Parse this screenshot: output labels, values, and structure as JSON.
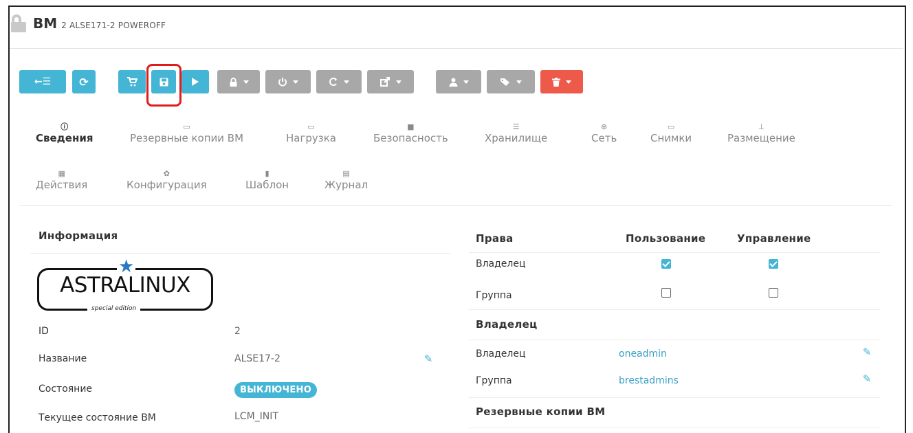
{
  "header": {
    "title": "ВМ",
    "subtitle": "2 ALSE171-2 POWEROFF"
  },
  "toolbar": {
    "buttons": [
      {
        "name": "back-list-button",
        "icon": "←☰",
        "caret": false,
        "color": "#45b5d6"
      },
      {
        "name": "refresh-button",
        "icon": "⟳",
        "caret": false,
        "color": "#45b5d6"
      },
      {
        "name": "deploy-cart-button",
        "icon": "🛒",
        "caret": false,
        "color": "#45b5d6"
      },
      {
        "name": "save-button",
        "icon": "💾",
        "caret": false,
        "color": "#45b5d6"
      },
      {
        "name": "play-button",
        "icon": "▶",
        "caret": false,
        "color": "#45b5d6"
      },
      {
        "name": "lock-menu-button",
        "icon": "🔒",
        "caret": true,
        "color": "#a8a8a8"
      },
      {
        "name": "power-menu-button",
        "icon": "⏻",
        "caret": true,
        "color": "#a8a8a8"
      },
      {
        "name": "reboot-menu-button",
        "icon": "↻",
        "caret": true,
        "color": "#a8a8a8"
      },
      {
        "name": "export-menu-button",
        "icon": "⇪",
        "caret": true,
        "color": "#a8a8a8"
      },
      {
        "name": "user-menu-button",
        "icon": "👤",
        "caret": true,
        "color": "#a8a8a8"
      },
      {
        "name": "tag-menu-button",
        "icon": "🏷",
        "caret": true,
        "color": "#a8a8a8"
      },
      {
        "name": "delete-menu-button",
        "icon": "🗑",
        "caret": true,
        "color": "#ee5a4a"
      }
    ]
  },
  "tabs": [
    {
      "label": "Сведения",
      "icon": "info-icon",
      "glyph": "ⓘ",
      "active": true
    },
    {
      "label": "Резервные копии ВМ",
      "icon": "archive-icon",
      "glyph": "▭",
      "active": false
    },
    {
      "label": "Нагрузка",
      "icon": "laptop-icon",
      "glyph": "▭",
      "active": false
    },
    {
      "label": "Безопасность",
      "icon": "lock-icon",
      "glyph": "🔒",
      "active": false
    },
    {
      "label": "Хранилище",
      "icon": "storage-icon",
      "glyph": "☰",
      "active": false
    },
    {
      "label": "Сеть",
      "icon": "globe-icon",
      "glyph": "⊕",
      "active": false
    },
    {
      "label": "Снимки",
      "icon": "laptop-icon",
      "glyph": "▭",
      "active": false
    },
    {
      "label": "Размещение",
      "icon": "sitemap-icon",
      "glyph": "⊥",
      "active": false
    },
    {
      "label": "Действия",
      "icon": "calendar-icon",
      "glyph": "▦",
      "active": false
    },
    {
      "label": "Конфигурация",
      "icon": "gear-icon",
      "glyph": "✿",
      "active": false
    },
    {
      "label": "Шаблон",
      "icon": "file-icon",
      "glyph": "▮",
      "active": false
    },
    {
      "label": "Журнал",
      "icon": "file-text-icon",
      "glyph": "▤",
      "active": false
    }
  ],
  "info": {
    "heading": "Информация",
    "logo": {
      "text": "ASTRALINUX",
      "tagline": "special edition"
    },
    "rows": [
      {
        "label": "ID",
        "value": "2"
      },
      {
        "label": "Название",
        "value": "ALSE17-2"
      },
      {
        "label": "Состояние",
        "value": "ВЫКЛЮЧЕНО"
      },
      {
        "label": "Текущее состояние ВМ",
        "value": "LCM_INIT"
      }
    ]
  },
  "permissions": {
    "heading": "Права",
    "col_use": "Пользование",
    "col_manage": "Управление",
    "rows": [
      {
        "label": "Владелец",
        "use": true,
        "manage": true
      },
      {
        "label": "Группа",
        "use": false,
        "manage": false
      }
    ]
  },
  "ownership": {
    "heading": "Владелец",
    "rows": [
      {
        "label": "Владелец",
        "value": "oneadmin"
      },
      {
        "label": "Группа",
        "value": "brestadmins"
      }
    ]
  },
  "backups": {
    "heading": "Резервные копии ВМ"
  },
  "colors": {
    "accent": "#45b5d6",
    "danger": "#ee5a4a",
    "neutral": "#a8a8a8",
    "highlight": "#e21b1b"
  }
}
